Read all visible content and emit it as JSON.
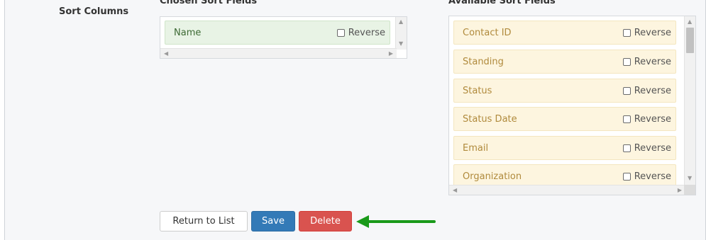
{
  "form": {
    "section_label": "Sort Columns",
    "chosen_header": "Chosen Sort Fields",
    "available_header": "Available Sort Fields",
    "reverse_label": "Reverse"
  },
  "chosen_fields": [
    {
      "label": "Name",
      "reverse": false
    }
  ],
  "available_fields": [
    {
      "label": "Contact ID",
      "reverse": false
    },
    {
      "label": "Standing",
      "reverse": false
    },
    {
      "label": "Status",
      "reverse": false
    },
    {
      "label": "Status Date",
      "reverse": false
    },
    {
      "label": "Email",
      "reverse": false
    },
    {
      "label": "Organization",
      "reverse": false
    }
  ],
  "buttons": {
    "return_label": "Return to List",
    "save_label": "Save",
    "delete_label": "Delete"
  },
  "colors": {
    "chosen_bg": "#e8f3e5",
    "available_bg": "#fdf5df",
    "save_bg": "#337ab7",
    "delete_bg": "#d9534f",
    "annotation_arrow": "#1a9a1a"
  },
  "icons": {
    "annotation": "green-arrow-icon",
    "scroll_up": "scroll-up-icon",
    "scroll_down": "scroll-down-icon",
    "scroll_left": "scroll-left-icon",
    "scroll_right": "scroll-right-icon"
  }
}
